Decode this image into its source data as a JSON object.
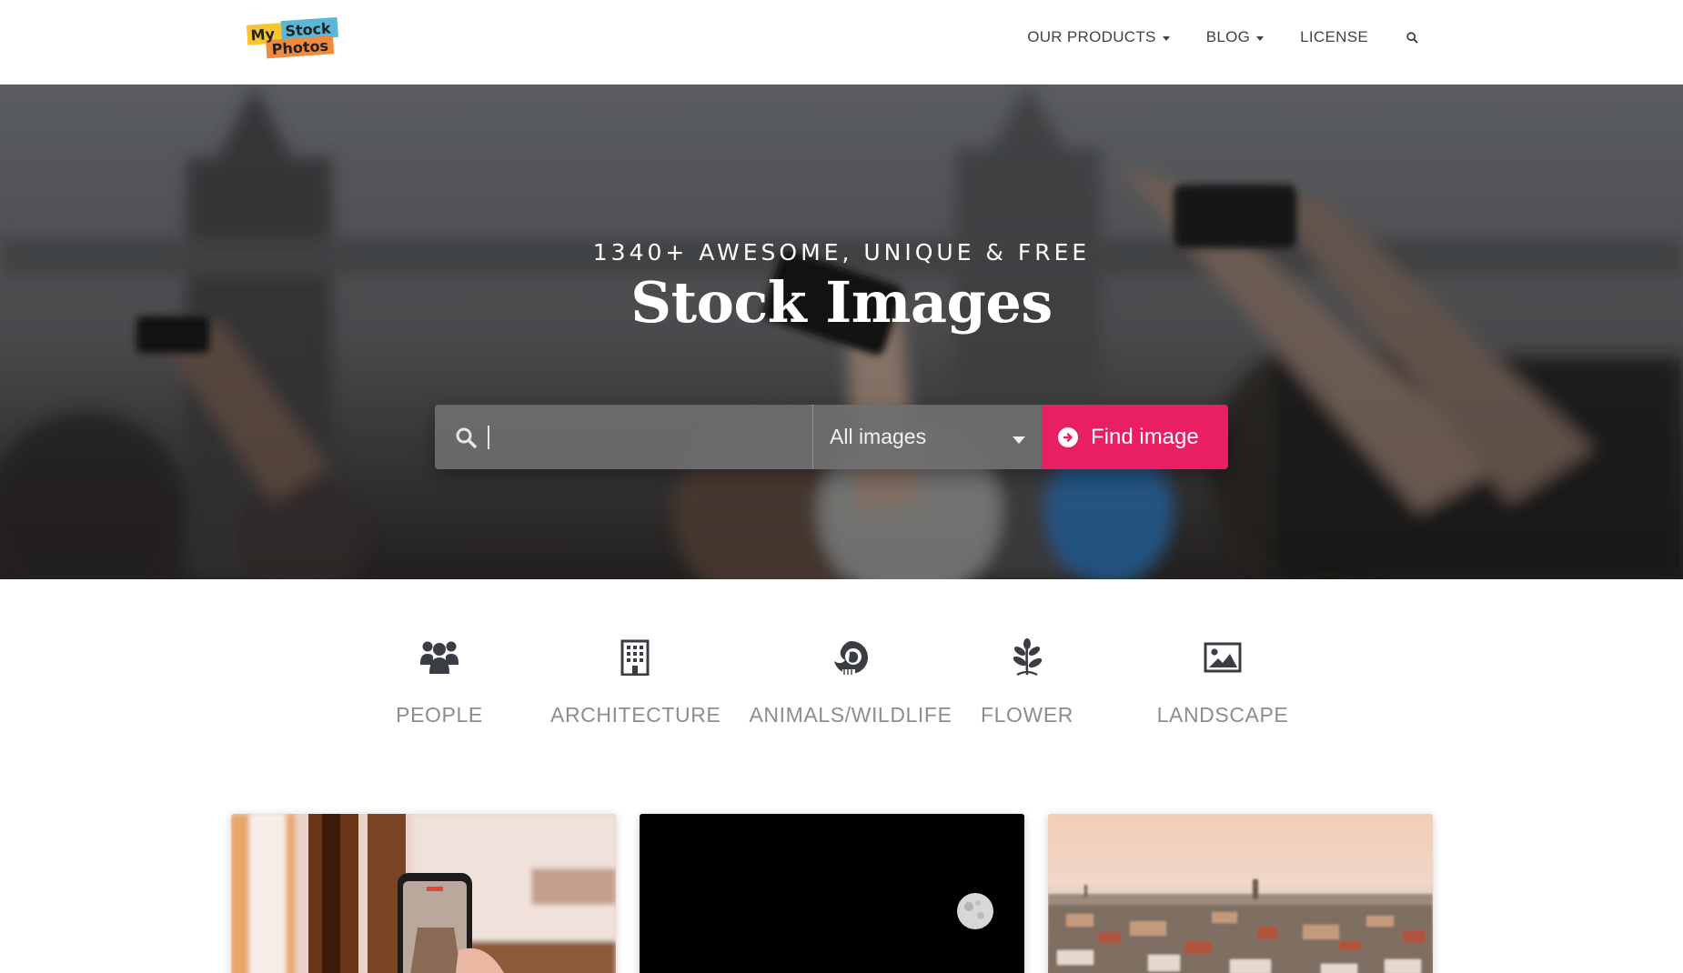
{
  "header": {
    "logo_line1_a": "My",
    "logo_line1_b": "Stock",
    "logo_line2": "Photos",
    "nav": [
      {
        "label": "OUR PRODUCTS",
        "dropdown": true
      },
      {
        "label": "BLOG",
        "dropdown": true
      },
      {
        "label": "LICENSE",
        "dropdown": false
      }
    ],
    "search_icon": "search-icon"
  },
  "hero": {
    "subtitle": "1340+ AWESOME, UNIQUE & FREE",
    "title": "Stock Images",
    "search": {
      "value": "",
      "placeholder": ""
    },
    "select_value": "All images",
    "button_label": "Find image",
    "button_icon": "arrow-circle-right-icon",
    "accent_color": "#e91e63"
  },
  "categories": [
    {
      "label": "PEOPLE",
      "icon": "users-icon"
    },
    {
      "label": "ARCHITECTURE",
      "icon": "building-icon"
    },
    {
      "label": "ANIMALS/WILDLIFE",
      "icon": "animal-icon"
    },
    {
      "label": "FLOWER",
      "icon": "plant-icon"
    },
    {
      "label": "LANDSCAPE",
      "icon": "image-icon"
    }
  ],
  "cards": [
    {
      "subject": "hand-holding-phone-photo"
    },
    {
      "subject": "moon-night-sky-photo"
    },
    {
      "subject": "city-skyline-photo"
    }
  ]
}
